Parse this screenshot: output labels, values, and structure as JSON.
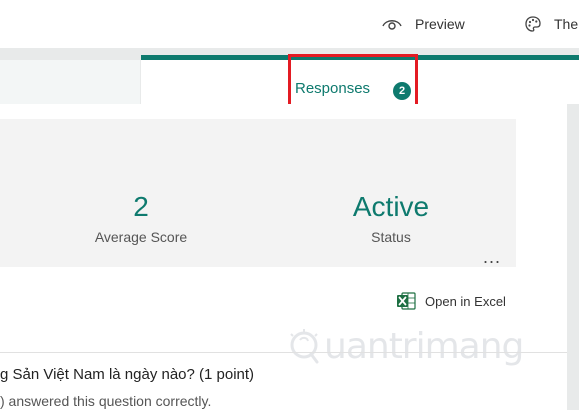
{
  "topbar": {
    "preview_label": "Preview",
    "preview_icon": "eye-icon",
    "theme_label": "The",
    "theme_icon": "palette-icon"
  },
  "tabs": {
    "responses_label": "Responses",
    "responses_count": "2",
    "active_tab": "responses"
  },
  "stats": {
    "average_score_value": "2",
    "average_score_label": "Average Score",
    "status_value": "Active",
    "status_label": "Status",
    "more_label": "..."
  },
  "actions": {
    "open_in_excel_label": "Open in Excel",
    "excel_icon": "excel-icon"
  },
  "watermark": {
    "text": "uantrimang"
  },
  "question": {
    "title": "g Sản Việt Nam là ngày nào? (1 point)",
    "subtitle": ") answered this question correctly."
  },
  "colors": {
    "accent": "#0e7a6e",
    "highlight": "#e31b23",
    "background": "#e8eaea",
    "card": "#f3f3f3",
    "excel_green": "#1d6f42"
  }
}
